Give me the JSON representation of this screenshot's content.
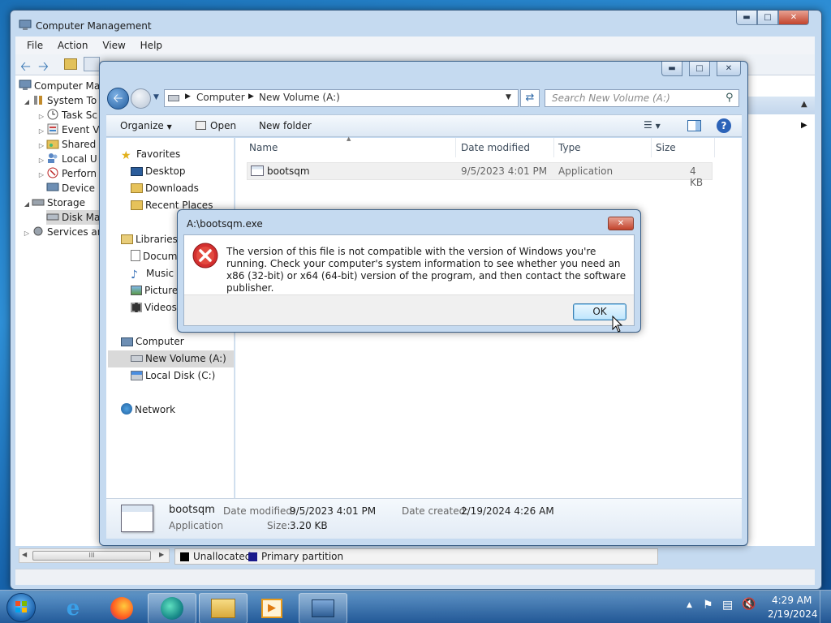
{
  "colors": {
    "accent": "#3c7fb1",
    "error": "#d32f2f",
    "selection": "#cce0f5"
  },
  "cm": {
    "title": "Computer Management",
    "menu": [
      "File",
      "Action",
      "View",
      "Help"
    ],
    "tree": [
      {
        "label": "Computer Ma",
        "icon": "computer-icon",
        "expander": ""
      },
      {
        "label": "System To",
        "icon": "tools-icon",
        "expander": "open"
      },
      {
        "label": "Task Sc",
        "icon": "clock-icon",
        "expander": "closed"
      },
      {
        "label": "Event V",
        "icon": "event-viewer-icon",
        "expander": "closed"
      },
      {
        "label": "Shared",
        "icon": "shared-folder-icon",
        "expander": "closed"
      },
      {
        "label": "Local U",
        "icon": "users-icon",
        "expander": "closed"
      },
      {
        "label": "Perforn",
        "icon": "performance-icon",
        "expander": "closed"
      },
      {
        "label": "Device",
        "icon": "device-manager-icon",
        "expander": ""
      },
      {
        "label": "Storage",
        "icon": "storage-icon",
        "expander": "open"
      },
      {
        "label": "Disk Ma",
        "icon": "disk-icon",
        "expander": ""
      },
      {
        "label": "Services an",
        "icon": "services-icon",
        "expander": "closed"
      }
    ],
    "legend": {
      "unallocated": "Unallocated",
      "primary": "Primary partition"
    },
    "scroll_grip": "III"
  },
  "explorer": {
    "breadcrumb": [
      "Computer",
      "New Volume (A:)"
    ],
    "search_placeholder": "Search New Volume (A:)",
    "toolbar": {
      "organize": "Organize",
      "open": "Open",
      "new_folder": "New folder"
    },
    "nav": [
      {
        "label": "Favorites",
        "icon": "star-icon",
        "group": true
      },
      {
        "label": "Desktop",
        "icon": "desktop-icon"
      },
      {
        "label": "Downloads",
        "icon": "downloads-icon"
      },
      {
        "label": "Recent Places",
        "icon": "recent-places-icon"
      },
      {
        "label": "Libraries",
        "icon": "libraries-icon",
        "group": true
      },
      {
        "label": "Docum",
        "icon": "documents-icon"
      },
      {
        "label": "Music",
        "icon": "music-icon"
      },
      {
        "label": "Picture",
        "icon": "pictures-icon"
      },
      {
        "label": "Videos",
        "icon": "videos-icon"
      },
      {
        "label": "Computer",
        "icon": "computer-icon",
        "group": true
      },
      {
        "label": "New Volume (A:)",
        "icon": "drive-icon",
        "selected": true
      },
      {
        "label": "Local Disk (C:)",
        "icon": "local-disk-icon"
      },
      {
        "label": "Network",
        "icon": "network-icon",
        "group": true
      }
    ],
    "columns": [
      "Name",
      "Date modified",
      "Type",
      "Size"
    ],
    "files": [
      {
        "name": "bootsqm",
        "date": "9/5/2023 4:01 PM",
        "type": "Application",
        "size": "4 KB"
      }
    ],
    "details": {
      "name": "bootsqm",
      "type": "Application",
      "modified_label": "Date modified:",
      "modified": "9/5/2023 4:01 PM",
      "size_label": "Size:",
      "size": "3.20 KB",
      "created_label": "Date created:",
      "created": "2/19/2024 4:26 AM"
    }
  },
  "dialog": {
    "title": "A:\\bootsqm.exe",
    "message": "The version of this file is not compatible with the version of Windows you're running. Check your computer's system information to see whether you need an x86 (32-bit) or x64 (64-bit) version of the program, and then contact the software publisher.",
    "ok": "OK"
  },
  "taskbar": {
    "apps": [
      "internet-explorer-icon",
      "firefox-icon",
      "edge-icon",
      "file-explorer-icon",
      "media-player-icon",
      "computer-management-icon"
    ],
    "time": "4:29 AM",
    "date": "2/19/2024"
  }
}
